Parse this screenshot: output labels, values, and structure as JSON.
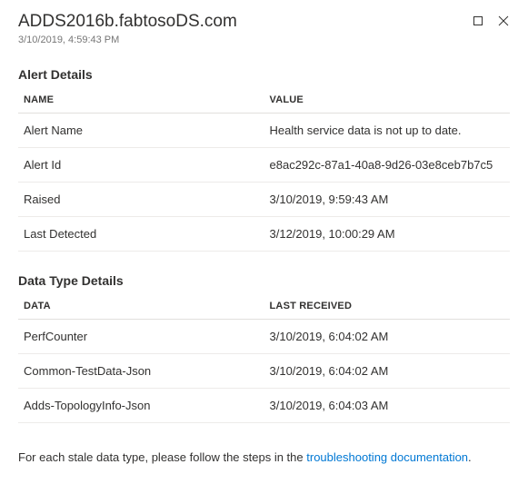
{
  "header": {
    "title": "ADDS2016b.fabtosoDS.com",
    "timestamp": "3/10/2019, 4:59:43 PM"
  },
  "alert_details": {
    "section_title": "Alert Details",
    "columns": {
      "name": "NAME",
      "value": "VALUE"
    },
    "rows": [
      {
        "name": "Alert Name",
        "value": "Health service data is not up to date."
      },
      {
        "name": "Alert Id",
        "value": "e8ac292c-87a1-40a8-9d26-03e8ceb7b7c5"
      },
      {
        "name": "Raised",
        "value": "3/10/2019, 9:59:43 AM"
      },
      {
        "name": "Last Detected",
        "value": "3/12/2019, 10:00:29 AM"
      }
    ]
  },
  "data_type_details": {
    "section_title": "Data Type Details",
    "columns": {
      "data": "DATA",
      "last_received": "LAST RECEIVED"
    },
    "rows": [
      {
        "data": "PerfCounter",
        "last_received": "3/10/2019, 6:04:02 AM"
      },
      {
        "data": "Common-TestData-Json",
        "last_received": "3/10/2019, 6:04:02 AM"
      },
      {
        "data": "Adds-TopologyInfo-Json",
        "last_received": "3/10/2019, 6:04:03 AM"
      }
    ]
  },
  "footer": {
    "prefix": "For each stale data type, please follow the steps in the ",
    "link_text": "troubleshooting documentation",
    "suffix": "."
  }
}
